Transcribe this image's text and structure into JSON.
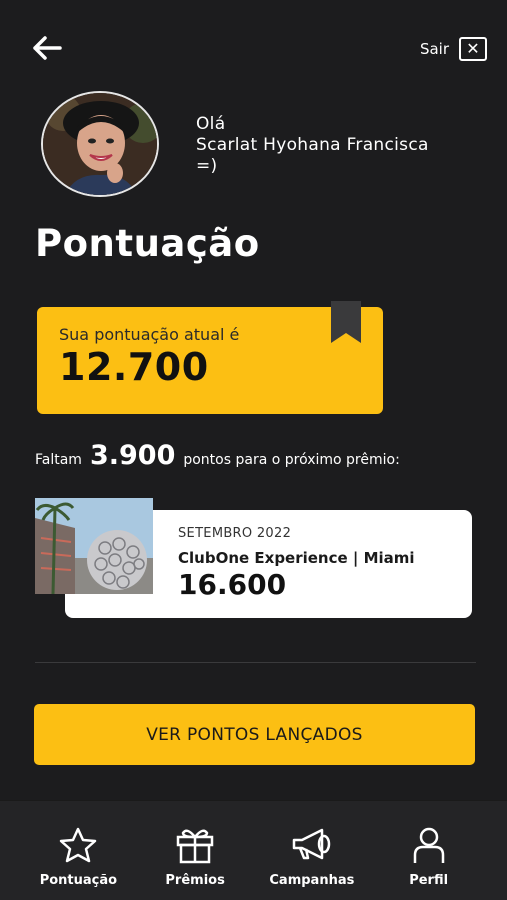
{
  "header": {
    "back_icon": "arrow-left-icon",
    "logout_label": "Sair",
    "logout_icon": "close-box-icon"
  },
  "profile": {
    "greeting_line1": "Olá",
    "name": "Scarlat Hyohana Francisca",
    "emoticon": "=)"
  },
  "page": {
    "title": "Pontuação"
  },
  "score": {
    "label": "Sua pontuação atual é",
    "value": "12.700",
    "bookmark_icon": "bookmark-icon"
  },
  "progress": {
    "prefix": "Faltam",
    "value": "3.900",
    "suffix": "pontos para o próximo prêmio:"
  },
  "prize": {
    "date": "SETEMBRO 2022",
    "name": "ClubOne Experience | Miami",
    "points": "16.600"
  },
  "cta": {
    "label": "VER PONTOS LANÇADOS"
  },
  "bottom_nav": {
    "items": [
      {
        "label": "Pontuação",
        "icon": "star-icon"
      },
      {
        "label": "Prêmios",
        "icon": "gift-icon"
      },
      {
        "label": "Campanhas",
        "icon": "megaphone-icon"
      },
      {
        "label": "Perfil",
        "icon": "user-icon"
      }
    ]
  },
  "colors": {
    "background": "#1c1c1e",
    "accent": "#fcbf13",
    "card": "#ffffff",
    "nav_background": "#242426"
  }
}
